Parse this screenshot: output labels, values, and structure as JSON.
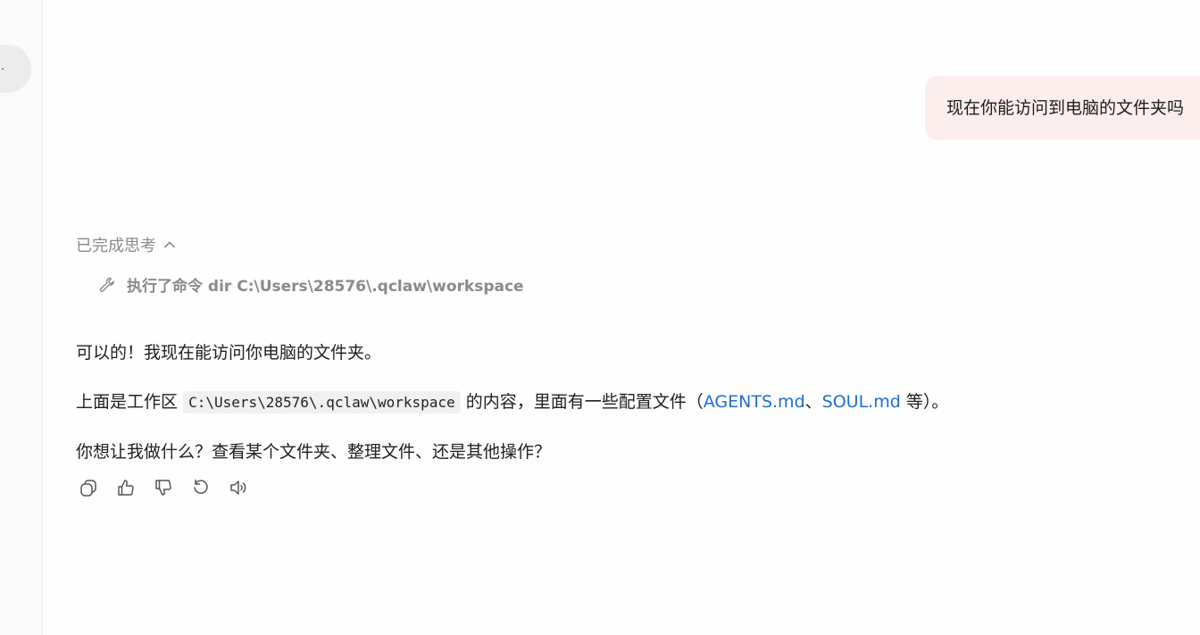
{
  "sidebar": {
    "avatar_glyph": "."
  },
  "conversation": {
    "user_message": "现在你能访问到电脑的文件夹吗",
    "thinking": {
      "label": "已完成思考",
      "toggle_icon": "chevron-up-icon"
    },
    "tool_step": {
      "icon": "wrench-icon",
      "text": "执行了命令 dir C:\\Users\\28576\\.qclaw\\workspace"
    },
    "answer": {
      "p1": "可以的！我现在能访问你电脑的文件夹。",
      "p2_prefix": "上面是工作区",
      "p2_code": "C:\\Users\\28576\\.qclaw\\workspace",
      "p2_mid": "的内容，里面有一些配置文件（",
      "p2_link1": "AGENTS.md",
      "p2_sep": "、",
      "p2_link2": "SOUL.md",
      "p2_suffix": " 等）。",
      "p3": "你想让我做什么？查看某个文件夹、整理文件、还是其他操作？"
    },
    "actions": [
      "copy-icon",
      "thumbs-up-icon",
      "thumbs-down-icon",
      "regenerate-icon",
      "speaker-icon"
    ]
  },
  "colors": {
    "user_bubble": "#fdeeee",
    "link": "#1f6fd1",
    "muted_text": "#8a8a8a",
    "code_bg": "#f0f0f0"
  }
}
